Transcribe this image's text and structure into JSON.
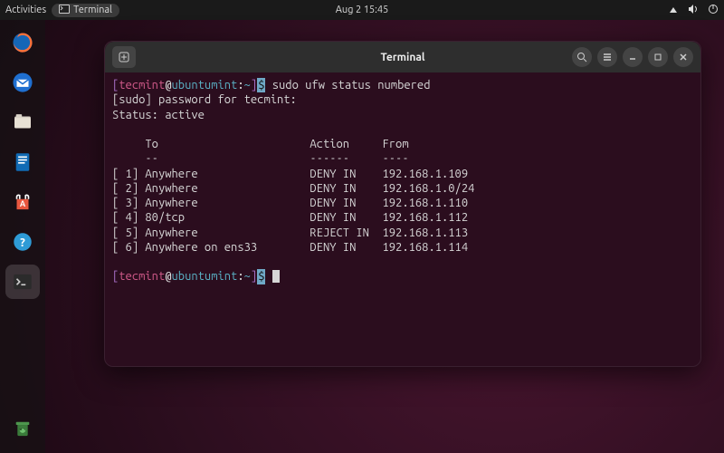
{
  "topbar": {
    "activities": "Activities",
    "app_label": "Terminal",
    "datetime": "Aug 2  15:45"
  },
  "dock": {
    "items": [
      {
        "name": "firefox-icon"
      },
      {
        "name": "thunderbird-icon"
      },
      {
        "name": "files-icon"
      },
      {
        "name": "writer-icon"
      },
      {
        "name": "software-icon"
      },
      {
        "name": "help-icon"
      },
      {
        "name": "terminal-icon"
      },
      {
        "name": "trash-icon"
      }
    ]
  },
  "window": {
    "title": "Terminal"
  },
  "prompt": {
    "user": "tecmint",
    "host": "ubuntumint",
    "path": "~",
    "command": "sudo ufw status numbered"
  },
  "output": {
    "sudo_line": "[sudo] password for tecmint:",
    "status_line": "Status: active",
    "header": {
      "to": "To",
      "action": "Action",
      "from": "From"
    },
    "divider": {
      "to": "--",
      "action": "------",
      "from": "----"
    },
    "rules": [
      {
        "n": "1",
        "to": "Anywhere",
        "action": "DENY IN",
        "from": "192.168.1.109"
      },
      {
        "n": "2",
        "to": "Anywhere",
        "action": "DENY IN",
        "from": "192.168.1.0/24"
      },
      {
        "n": "3",
        "to": "Anywhere",
        "action": "DENY IN",
        "from": "192.168.1.110"
      },
      {
        "n": "4",
        "to": "80/tcp",
        "action": "DENY IN",
        "from": "192.168.1.112"
      },
      {
        "n": "5",
        "to": "Anywhere",
        "action": "REJECT IN",
        "from": "192.168.1.113"
      },
      {
        "n": "6",
        "to": "Anywhere on ens33",
        "action": "DENY IN",
        "from": "192.168.1.114"
      }
    ]
  }
}
